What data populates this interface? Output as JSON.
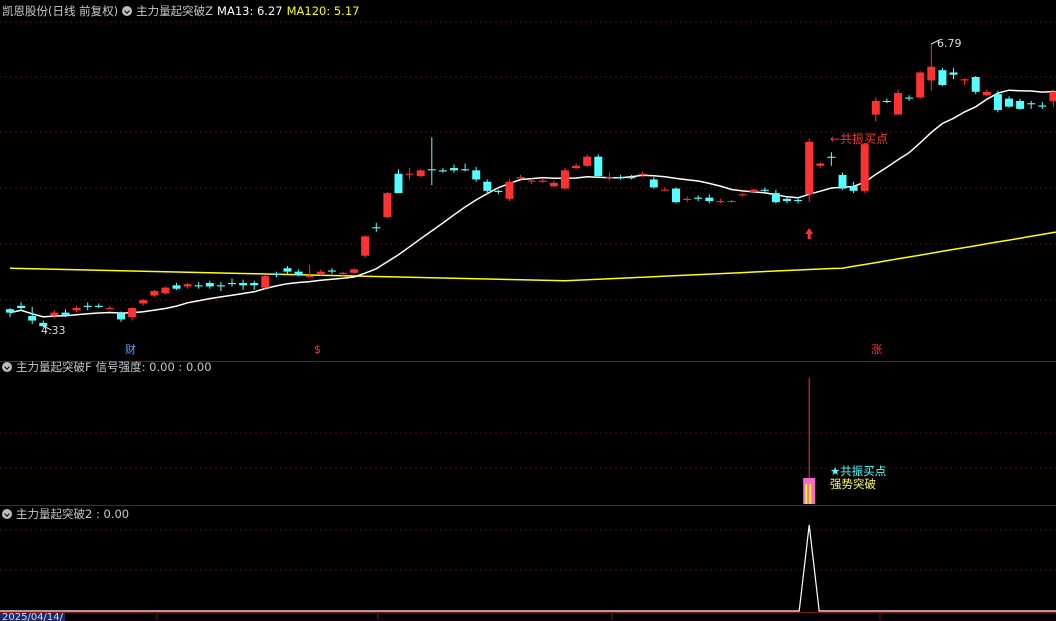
{
  "main_panel": {
    "stock_label": "凯恩股份(日线 前复权)",
    "indicator_name": "主力量起突破Z",
    "ma13_label": "MA13: 6.27",
    "ma120_label": "MA120: 5.17",
    "high_price": "6.79",
    "low_price": "4.33",
    "buy_signal_label": "←共振买点",
    "event_markers": [
      "财",
      "$",
      "涨"
    ],
    "colors": {
      "up": "#ff3232",
      "down": "#54ffff",
      "ma13": "#ffffff",
      "ma120": "#ffff00"
    }
  },
  "signal_panel": {
    "indicator_name": "主力量起突破F",
    "strength_label": "信号强度: 0.00 : 0.00",
    "buy_point_label": "★共振买点",
    "breakout_label": "强势突破"
  },
  "panel3": {
    "indicator_name": "主力量起突破2 : 0.00"
  },
  "date_axis": {
    "first_date": "2025/04/14/"
  },
  "chart_data": {
    "type": "candlestick",
    "series": [
      {
        "name": "MA13",
        "value": 6.27
      },
      {
        "name": "MA120",
        "value": 5.17
      }
    ],
    "high": 6.79,
    "low": 4.33,
    "ohlc": [
      [
        4.46,
        4.47,
        4.39,
        4.43
      ],
      [
        4.49,
        4.52,
        4.45,
        4.47
      ],
      [
        4.4,
        4.48,
        4.33,
        4.36
      ],
      [
        4.34,
        4.36,
        4.3,
        4.31
      ],
      [
        4.41,
        4.45,
        4.38,
        4.43
      ],
      [
        4.43,
        4.46,
        4.39,
        4.41
      ],
      [
        4.45,
        4.49,
        4.43,
        4.47
      ],
      [
        4.49,
        4.52,
        4.45,
        4.48
      ],
      [
        4.49,
        4.51,
        4.47,
        4.48
      ],
      [
        4.47,
        4.49,
        4.46,
        4.47
      ],
      [
        4.42,
        4.44,
        4.35,
        4.37
      ],
      [
        4.39,
        4.48,
        4.36,
        4.47
      ],
      [
        4.51,
        4.55,
        4.49,
        4.54
      ],
      [
        4.58,
        4.63,
        4.57,
        4.62
      ],
      [
        4.6,
        4.66,
        4.59,
        4.65
      ],
      [
        4.67,
        4.69,
        4.63,
        4.64
      ],
      [
        4.66,
        4.69,
        4.64,
        4.68
      ],
      [
        4.67,
        4.7,
        4.64,
        4.66
      ],
      [
        4.69,
        4.71,
        4.64,
        4.66
      ],
      [
        4.67,
        4.7,
        4.62,
        4.66
      ],
      [
        4.69,
        4.73,
        4.66,
        4.68
      ],
      [
        4.69,
        4.72,
        4.63,
        4.67
      ],
      [
        4.69,
        4.71,
        4.63,
        4.67
      ],
      [
        4.65,
        4.76,
        4.63,
        4.75
      ],
      [
        4.77,
        4.79,
        4.74,
        4.76
      ],
      [
        4.82,
        4.84,
        4.76,
        4.79
      ],
      [
        4.79,
        4.81,
        4.75,
        4.76
      ],
      [
        4.75,
        4.85,
        4.74,
        4.75
      ],
      [
        4.77,
        4.81,
        4.75,
        4.79
      ],
      [
        4.8,
        4.82,
        4.77,
        4.79
      ],
      [
        4.77,
        4.79,
        4.75,
        4.78
      ],
      [
        4.78,
        4.82,
        4.77,
        4.81
      ],
      [
        4.93,
        5.11,
        4.91,
        5.1
      ],
      [
        5.18,
        5.22,
        5.14,
        5.17
      ],
      [
        5.27,
        5.49,
        5.26,
        5.48
      ],
      [
        5.65,
        5.69,
        5.48,
        5.48
      ],
      [
        5.65,
        5.7,
        5.6,
        5.65
      ],
      [
        5.63,
        5.69,
        5.62,
        5.68
      ],
      [
        5.69,
        5.97,
        5.55,
        5.68
      ],
      [
        5.68,
        5.7,
        5.66,
        5.67
      ],
      [
        5.7,
        5.73,
        5.66,
        5.68
      ],
      [
        5.69,
        5.74,
        5.67,
        5.68
      ],
      [
        5.68,
        5.71,
        5.58,
        5.6
      ],
      [
        5.58,
        5.6,
        5.47,
        5.5
      ],
      [
        5.5,
        5.51,
        5.47,
        5.49
      ],
      [
        5.43,
        5.6,
        5.41,
        5.58
      ],
      [
        5.61,
        5.64,
        5.6,
        5.62
      ],
      [
        5.59,
        5.61,
        5.56,
        5.59
      ],
      [
        5.58,
        5.61,
        5.57,
        5.59
      ],
      [
        5.54,
        5.59,
        5.53,
        5.57
      ],
      [
        5.52,
        5.7,
        5.51,
        5.68
      ],
      [
        5.7,
        5.74,
        5.69,
        5.72
      ],
      [
        5.72,
        5.82,
        5.71,
        5.8
      ],
      [
        5.8,
        5.82,
        5.62,
        5.63
      ],
      [
        5.61,
        5.66,
        5.59,
        5.62
      ],
      [
        5.62,
        5.64,
        5.6,
        5.61
      ],
      [
        5.62,
        5.64,
        5.6,
        5.61
      ],
      [
        5.64,
        5.67,
        5.62,
        5.65
      ],
      [
        5.6,
        5.62,
        5.52,
        5.53
      ],
      [
        5.51,
        5.53,
        5.5,
        5.51
      ],
      [
        5.52,
        5.53,
        5.39,
        5.4
      ],
      [
        5.42,
        5.45,
        5.4,
        5.43
      ],
      [
        5.44,
        5.46,
        5.41,
        5.43
      ],
      [
        5.44,
        5.47,
        5.39,
        5.41
      ],
      [
        5.41,
        5.43,
        5.39,
        5.41
      ],
      [
        5.41,
        5.42,
        5.4,
        5.41
      ],
      [
        5.46,
        5.48,
        5.45,
        5.47
      ],
      [
        5.49,
        5.52,
        5.48,
        5.51
      ],
      [
        5.51,
        5.53,
        5.49,
        5.5
      ],
      [
        5.48,
        5.51,
        5.39,
        5.4
      ],
      [
        5.43,
        5.45,
        5.39,
        5.41
      ],
      [
        5.42,
        5.44,
        5.39,
        5.41
      ],
      [
        5.47,
        5.96,
        5.4,
        5.93
      ],
      [
        5.72,
        5.75,
        5.7,
        5.74
      ],
      [
        5.8,
        5.84,
        5.72,
        5.79
      ],
      [
        5.64,
        5.66,
        5.51,
        5.52
      ],
      [
        5.54,
        5.58,
        5.48,
        5.5
      ],
      [
        5.5,
        5.92,
        5.48,
        5.91
      ],
      [
        6.17,
        6.32,
        6.11,
        6.29
      ],
      [
        6.29,
        6.31,
        6.27,
        6.28
      ],
      [
        6.17,
        6.39,
        6.18,
        6.36
      ],
      [
        6.32,
        6.34,
        6.29,
        6.31
      ],
      [
        6.32,
        6.55,
        6.31,
        6.54
      ],
      [
        6.47,
        6.79,
        6.38,
        6.59
      ],
      [
        6.56,
        6.58,
        6.42,
        6.43
      ],
      [
        6.54,
        6.58,
        6.48,
        6.52
      ],
      [
        6.47,
        6.49,
        6.43,
        6.48
      ],
      [
        6.5,
        6.51,
        6.35,
        6.37
      ],
      [
        6.34,
        6.39,
        6.33,
        6.37
      ],
      [
        6.35,
        6.38,
        6.19,
        6.21
      ],
      [
        6.31,
        6.33,
        6.23,
        6.24
      ],
      [
        6.29,
        6.31,
        6.21,
        6.22
      ],
      [
        6.27,
        6.29,
        6.22,
        6.26
      ],
      [
        6.25,
        6.28,
        6.22,
        6.24
      ],
      [
        6.29,
        6.39,
        6.24,
        6.37
      ],
      [
        6.32,
        6.34,
        6.25,
        6.27
      ]
    ]
  }
}
